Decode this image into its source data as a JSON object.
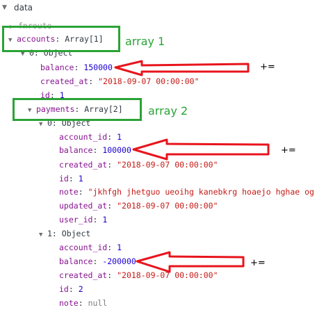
{
  "root": {
    "label": "data"
  },
  "rows": {
    "fnroute": {
      "key": "fnroute"
    },
    "accounts": {
      "key": "accounts",
      "summary": "Array[1]"
    },
    "acc0": {
      "label": "0: Object"
    },
    "acc_balance": {
      "key": "balance",
      "value": "150000"
    },
    "acc_created": {
      "key": "created_at",
      "value": "\"2018-09-07 00:00:00\""
    },
    "acc_id": {
      "key": "id",
      "value": "1"
    },
    "payments": {
      "key": "payments",
      "summary": "Array[2]"
    },
    "pay0": {
      "label": "0: Object"
    },
    "p0_account_id": {
      "key": "account_id",
      "value": "1"
    },
    "p0_balance": {
      "key": "balance",
      "value": "100000"
    },
    "p0_created": {
      "key": "created_at",
      "value": "\"2018-09-07 00:00:00\""
    },
    "p0_id": {
      "key": "id",
      "value": "1"
    },
    "p0_note": {
      "key": "note",
      "value": "\"jkhfgh jhetguo ueoihg kanebkrg hoaejo hghae og"
    },
    "p0_updated": {
      "key": "updated_at",
      "value": "\"2018-09-07 00:00:00\""
    },
    "p0_user": {
      "key": "user_id",
      "value": "1"
    },
    "pay1": {
      "label": "1: Object"
    },
    "p1_account_id": {
      "key": "account_id",
      "value": "1"
    },
    "p1_balance": {
      "key": "balance",
      "value": "-200000"
    },
    "p1_created": {
      "key": "created_at",
      "value": "\"2018-09-07 00:00:00\""
    },
    "p1_id": {
      "key": "id",
      "value": "2"
    },
    "p1_note": {
      "key": "note",
      "value": "null"
    }
  },
  "annotations": {
    "array1": "array 1",
    "array2": "array 2",
    "plus_label": "+="
  },
  "colors": {
    "box": "#2aa336",
    "arrow": "#e8141c"
  }
}
